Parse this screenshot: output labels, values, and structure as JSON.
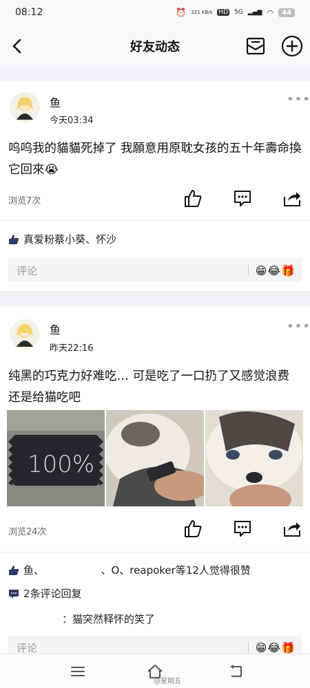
{
  "status_bar": {
    "time": "08:12",
    "network_speed": "221 KB/s",
    "hd": "HD",
    "signal": "5G",
    "battery": "44"
  },
  "header": {
    "title": "好友动态"
  },
  "posts": [
    {
      "author": "鱼",
      "time": "今天03:34",
      "text": "呜呜我的貓貓死掉了 我願意用原耽女孩的五十年壽命換它回來😭",
      "views": "浏览7次",
      "likes": "真爱粉蔡小葵、怀沙",
      "comment_placeholder": "评论",
      "emojis": [
        "😁",
        "😂",
        "🎁"
      ]
    },
    {
      "author": "鱼",
      "time": "昨天22:16",
      "text": "纯黑的巧克力好难吃… 可是吃了一口扔了又感觉浪费 还是给猫吃吧",
      "chocolate_label": "100%",
      "views": "浏览24次",
      "likes": "鱼、　　　　　　、O、reapoker等12人觉得很赞",
      "comment_count": "2条评论回复",
      "reply": "：猫突然释怀的笑了",
      "comment_placeholder": "评论",
      "emojis": [
        "😁",
        "😂",
        "🎁"
      ]
    }
  ],
  "watermark": "@星期五",
  "colors": {
    "page_bg": "#f2f3f6",
    "card_bg": "#ffffff",
    "like_icon": "#2b3a67",
    "muted_text": "#666666"
  },
  "icons": [
    "back-icon",
    "mail-icon",
    "add-icon",
    "more-icon",
    "thumbs-up-icon",
    "comment-icon",
    "share-icon",
    "menu-icon",
    "home-icon",
    "return-icon"
  ]
}
